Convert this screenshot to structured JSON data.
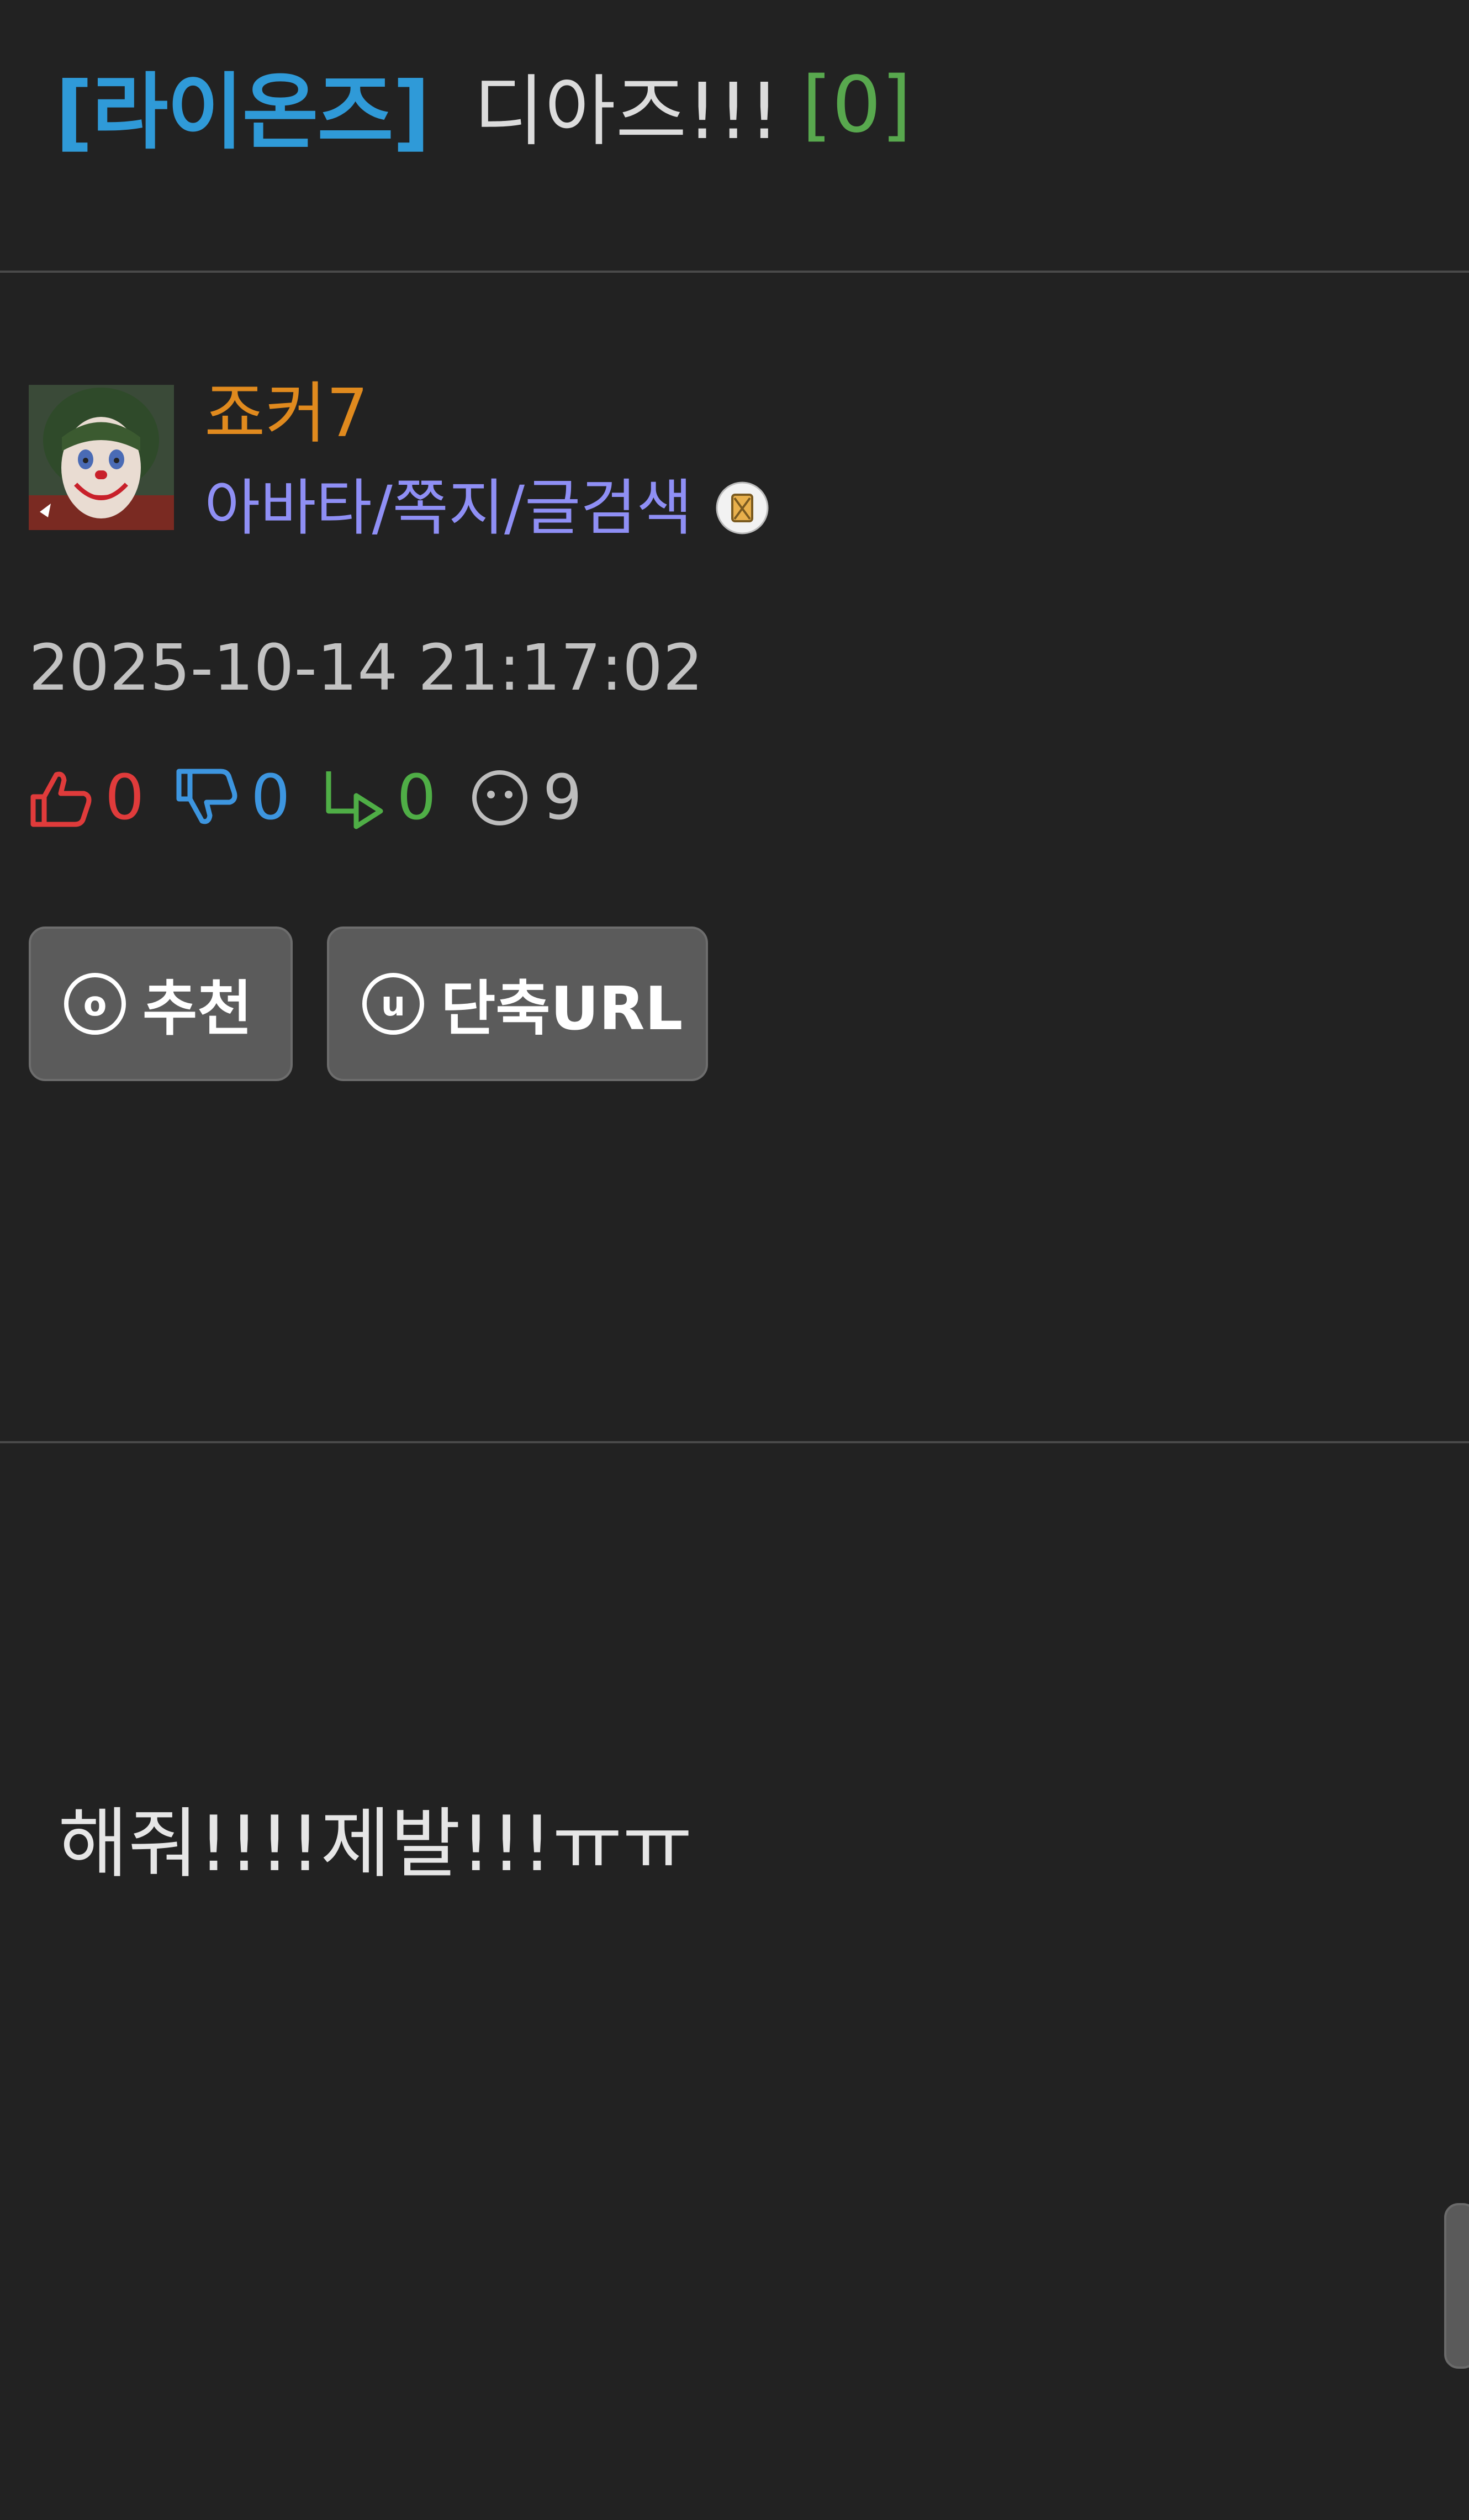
{
  "post": {
    "category": "[라이온즈]",
    "subject": "디아즈!!!",
    "comment_count": "[0]",
    "author": {
      "name": "죠커7",
      "links": "아바타/쪽지/글검색",
      "avatar_icon": "joker-avatar",
      "badge_icon": "member-level-badge-icon"
    },
    "date": "2025-10-14 21:17:02",
    "stats": {
      "upvotes": "0",
      "downvotes": "0",
      "replies": "0",
      "views": "9"
    },
    "buttons": {
      "recommend_icon_letter": "o",
      "recommend_label": "추천",
      "shorturl_icon_letter": "u",
      "shorturl_label": "단축URL"
    },
    "body": "해줘!!!!제발!!!ㅠㅠ"
  },
  "colors": {
    "background": "#222222",
    "category": "#2f9ad8",
    "comment_count": "#58a84e",
    "author_name": "#e08a1e",
    "author_links": "#8f8ff5",
    "upvote": "#e03b3b",
    "downvote": "#3d96e0",
    "reply": "#4fae46",
    "button_bg": "#5b5b5b"
  }
}
